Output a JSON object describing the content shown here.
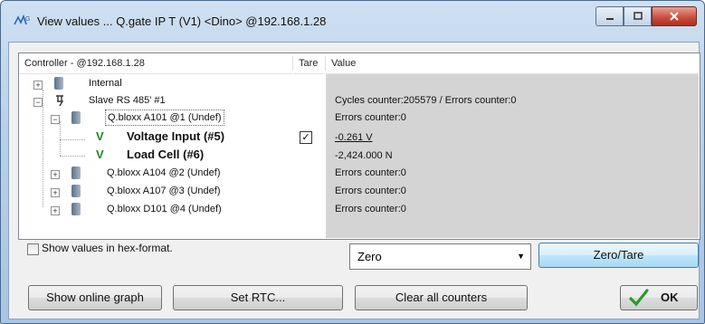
{
  "window": {
    "title": "View values ... Q.gate IP T (V1)  <Dino>  @192.168.1.28"
  },
  "tree": {
    "columns": {
      "controller": "Controller - @192.168.1.28",
      "tare": "Tare",
      "value": "Value"
    },
    "rows": [
      {
        "label": "Internal",
        "value": ""
      },
      {
        "label": "Slave RS 485' #1",
        "value": "Cycles counter:205579 / Errors counter:0"
      },
      {
        "label": "Q.bloxx A101 @1 (Undef)",
        "value": "Errors counter:0"
      },
      {
        "label": "Voltage Input (#5)",
        "value": "-0.261 V",
        "tare": "✓"
      },
      {
        "label": "Load Cell (#6)",
        "value": "-2,424.000 N"
      },
      {
        "label": "Q.bloxx A104 @2 (Undef)",
        "value": "Errors counter:0"
      },
      {
        "label": "Q.bloxx A107 @3 (Undef)",
        "value": "Errors counter:0"
      },
      {
        "label": "Q.bloxx D101 @4 (Undef)",
        "value": "Errors counter:0"
      }
    ],
    "expanders": {
      "plus": "+",
      "minus": "−"
    },
    "channel_glyph": "V"
  },
  "options": {
    "hex_label": "Show values in hex-format."
  },
  "zero_select": {
    "value": "Zero",
    "arrow": "▼"
  },
  "buttons": {
    "zero_tare": "Zero/Tare",
    "show_graph": "Show online graph",
    "set_rtc": "Set RTC...",
    "clear_counters": "Clear all counters",
    "ok": "OK"
  },
  "colors": {
    "accent": "#3c7fb1",
    "ok_check": "#2a9a2a",
    "channel_green": "#1a8a1a"
  }
}
